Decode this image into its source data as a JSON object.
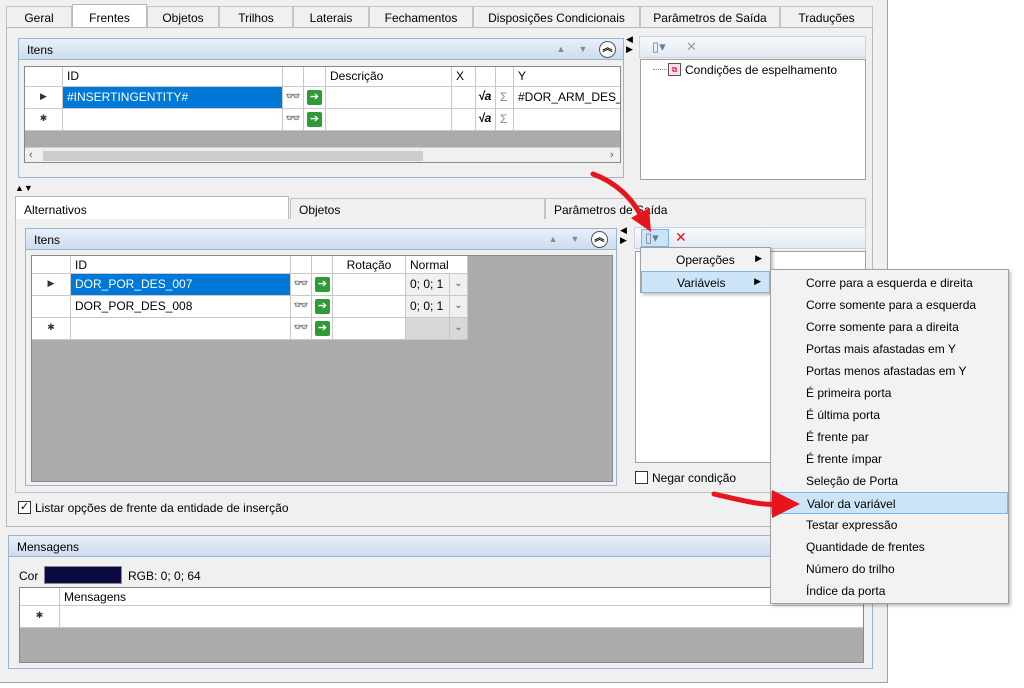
{
  "tabs": [
    "Geral",
    "Frentes",
    "Objetos",
    "Trilhos",
    "Laterais",
    "Fechamentos",
    "Disposições Condicionais",
    "Parâmetros de Saída",
    "Traduções"
  ],
  "active_tab": "Frentes",
  "itens_top": {
    "title": "Itens",
    "columns": [
      "ID",
      "Descrição",
      "X",
      "Y"
    ],
    "rows": [
      {
        "id": "#INSERTINGENTITY#",
        "descricao": "",
        "x": "",
        "y": "#DOR_ARM_DES_E"
      },
      {
        "id": "",
        "descricao": "",
        "x": "",
        "y": ""
      }
    ]
  },
  "conditions_tree": {
    "item": "Condições de espelhamento"
  },
  "sub_tabs": [
    "Alternativos",
    "Objetos",
    "Parâmetros de Saída"
  ],
  "itens_bottom": {
    "title": "Itens",
    "columns": [
      "ID",
      "Rotação",
      "Normal"
    ],
    "rows": [
      {
        "id": "DOR_POR_DES_007",
        "rotacao": "",
        "normal": "0; 0; 1"
      },
      {
        "id": "DOR_POR_DES_008",
        "rotacao": "",
        "normal": "0; 0; 1"
      },
      {
        "id": "",
        "rotacao": "",
        "normal": ""
      }
    ]
  },
  "negate_label": "Negar condição",
  "list_options_label": "Listar opções de frente da entidade de inserção",
  "messages": {
    "title": "Mensagens",
    "color_label": "Cor",
    "color_value": "#0a0a40",
    "rgb_text": "RGB: 0; 0; 64",
    "column": "Mensagens"
  },
  "context_menu": {
    "items": [
      "Operações",
      "Variáveis"
    ],
    "highlighted": "Variáveis"
  },
  "submenu": {
    "items": [
      "Corre para a esquerda e direita",
      "Corre somente para a esquerda",
      "Corre somente para a direita",
      "Portas mais afastadas em Y",
      "Portas menos afastadas em Y",
      "É primeira porta",
      "É última porta",
      "É frente par",
      "É frente ímpar",
      "Seleção de Porta",
      "Valor da variável",
      "Testar expressão",
      "Quantidade de frentes",
      "Número do trilho",
      "Índice da porta"
    ],
    "highlighted": "Valor da variável"
  },
  "icons": {
    "binoculars": "binoculars-icon",
    "go": "go-arrow-icon",
    "sqrt": "formula-icon",
    "sigma": "sigma-icon",
    "new_doc": "new-document-icon",
    "delete": "delete-icon"
  },
  "colors": {
    "selection": "#0078d7",
    "menu_highlight": "#cce4f7",
    "annotation_arrow": "#e8141c"
  }
}
